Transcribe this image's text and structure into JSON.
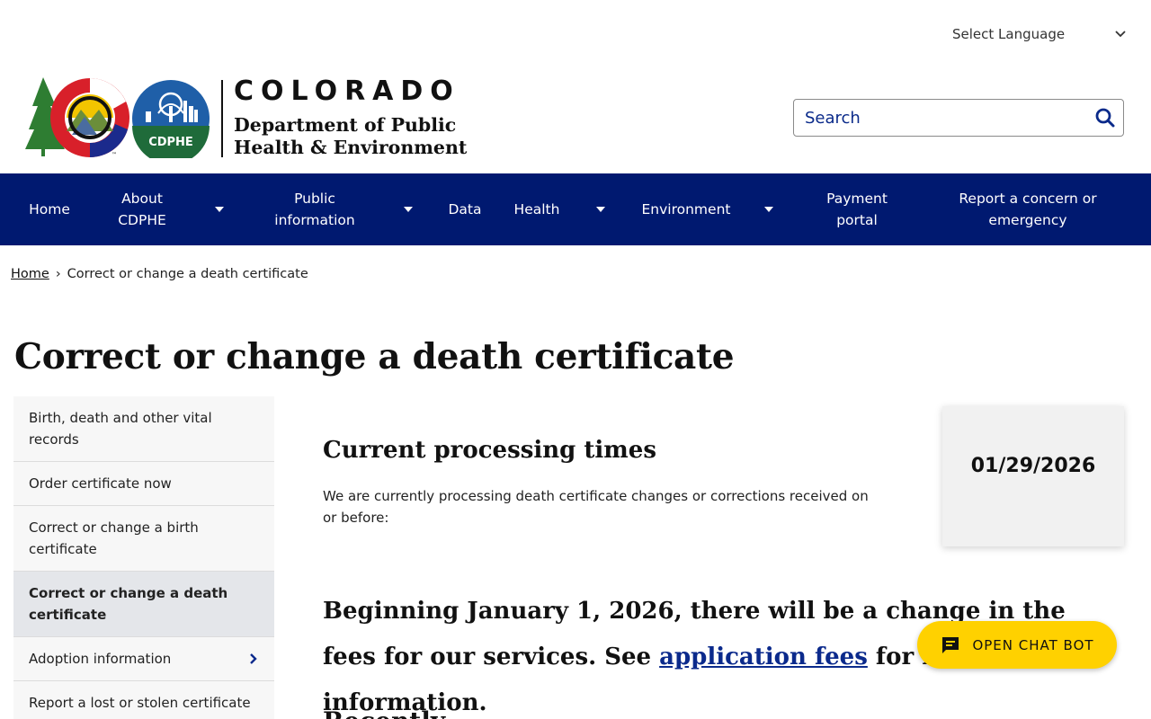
{
  "header": {
    "language_label": "Select Language",
    "logo_state": "COLORADO",
    "logo_dept_line1": "Department of Public",
    "logo_dept_line2": "Health & Environment",
    "logo_cdphe": "CDPHE",
    "search_placeholder": "Search"
  },
  "nav": {
    "items": [
      {
        "label": "Home"
      },
      {
        "label": "About CDPHE"
      },
      {
        "label": "Public information"
      },
      {
        "label": "Data"
      },
      {
        "label": "Health"
      },
      {
        "label": "Environment"
      },
      {
        "label": "Payment portal"
      },
      {
        "label": "Report a concern or emergency"
      }
    ]
  },
  "breadcrumb": {
    "home": "Home",
    "separator": "›",
    "current": "Correct or change a death certificate"
  },
  "page_title": "Correct or change a death certificate",
  "sidenav": {
    "items": [
      {
        "label": "Birth, death and other vital records"
      },
      {
        "label": "Order certificate now"
      },
      {
        "label": "Correct or change a birth certificate"
      },
      {
        "label": "Correct or change a death certificate"
      },
      {
        "label": "Adoption information"
      },
      {
        "label": "Report a lost or stolen certificate"
      }
    ]
  },
  "processing": {
    "title": "Current processing times",
    "text": "We are currently processing death certificate changes or corrections received on or before:",
    "date": "01/29/2026"
  },
  "fees": {
    "before": "Beginning January 1, 2026, there will be a change in the fees for our services. See ",
    "link": "application fees",
    "after": " for more information."
  },
  "next_heading": "Recently",
  "chatbot": {
    "label": "OPEN CHAT BOT"
  },
  "colors": {
    "nav_bg": "#001970",
    "chatbot_bg": "#ffd100",
    "link": "#0b2a8c",
    "active_sidenav_bg": "#e4e6ea"
  }
}
